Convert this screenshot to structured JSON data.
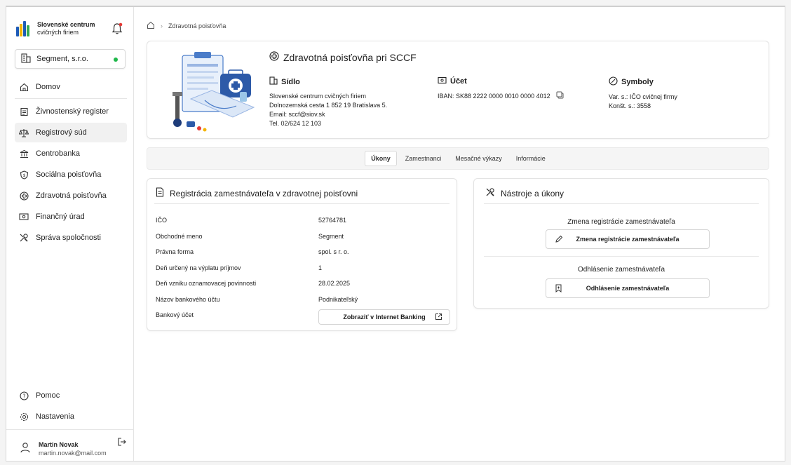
{
  "brand": {
    "line1": "Slovenské centrum",
    "line2": "cvičných firiem"
  },
  "company": {
    "name": "Segment, s.r.o."
  },
  "nav": {
    "items": [
      {
        "label": "Domov",
        "icon": "home-icon"
      },
      {
        "label": "Živnostenský register",
        "icon": "register-icon"
      },
      {
        "label": "Registrový súd",
        "icon": "scales-icon"
      },
      {
        "label": "Centrobanka",
        "icon": "bank-icon"
      },
      {
        "label": "Sociálna poisťovňa",
        "icon": "shield-icon"
      },
      {
        "label": "Zdravotná poisťovňa",
        "icon": "health-icon"
      },
      {
        "label": "Finančný úrad",
        "icon": "money-icon"
      },
      {
        "label": "Správa spoločnosti",
        "icon": "tools-icon"
      }
    ],
    "bottom": [
      {
        "label": "Pomoc",
        "icon": "help-icon"
      },
      {
        "label": "Nastavenia",
        "icon": "settings-icon"
      }
    ]
  },
  "user": {
    "name": "Martin Novak",
    "email": "martin.novak@mail.com"
  },
  "breadcrumb": {
    "current": "Zdravotná poisťovňa"
  },
  "header": {
    "title": "Zdravotná poisťovňa pri SCCF",
    "sidlo": {
      "heading": "Sídlo",
      "line1": "Slovenské centrum cvičných firiem",
      "line2": "Dolnozemská cesta 1 852 19 Bratislava 5.",
      "line3": "Email: sccf@siov.sk",
      "line4": "Tel. 02/624 12 103"
    },
    "ucet": {
      "heading": "Účet",
      "iban": "IBAN:  SK88 2222 0000 0010 0000 4012"
    },
    "symboly": {
      "heading": "Symboly",
      "line1": "Var. s.: IČO cvičnej firmy",
      "line2": "Konšt. s.: 3558"
    }
  },
  "tabs": [
    "Úkony",
    "Zamestnanci",
    "Mesačné výkazy",
    "Informácie"
  ],
  "registration": {
    "title": "Registrácia zamestnávateľa v zdravotnej poisťovni",
    "rows": [
      {
        "k": "IČO",
        "v": "52764781"
      },
      {
        "k": "Obchodné meno",
        "v": "Segment"
      },
      {
        "k": "Právna forma",
        "v": "spol. s r. o."
      },
      {
        "k": "Deň určený na výplatu príjmov",
        "v": "1"
      },
      {
        "k": "Deň vzniku oznamovacej povinnosti",
        "v": "28.02.2025"
      },
      {
        "k": "Názov bankového účtu",
        "v": "Podnikateľský"
      },
      {
        "k": "Bankový účet",
        "v": ""
      }
    ],
    "bank_button": "Zobraziť v Internet Banking"
  },
  "tools": {
    "title": "Nástroje a úkony",
    "section1": {
      "title": "Zmena registrácie zamestnávateľa",
      "button": "Zmena registrácie zamestnávateľa"
    },
    "section2": {
      "title": "Odhlásenie zamestnávateľa",
      "button": "Odhlásenie zamestnávateľa"
    }
  }
}
